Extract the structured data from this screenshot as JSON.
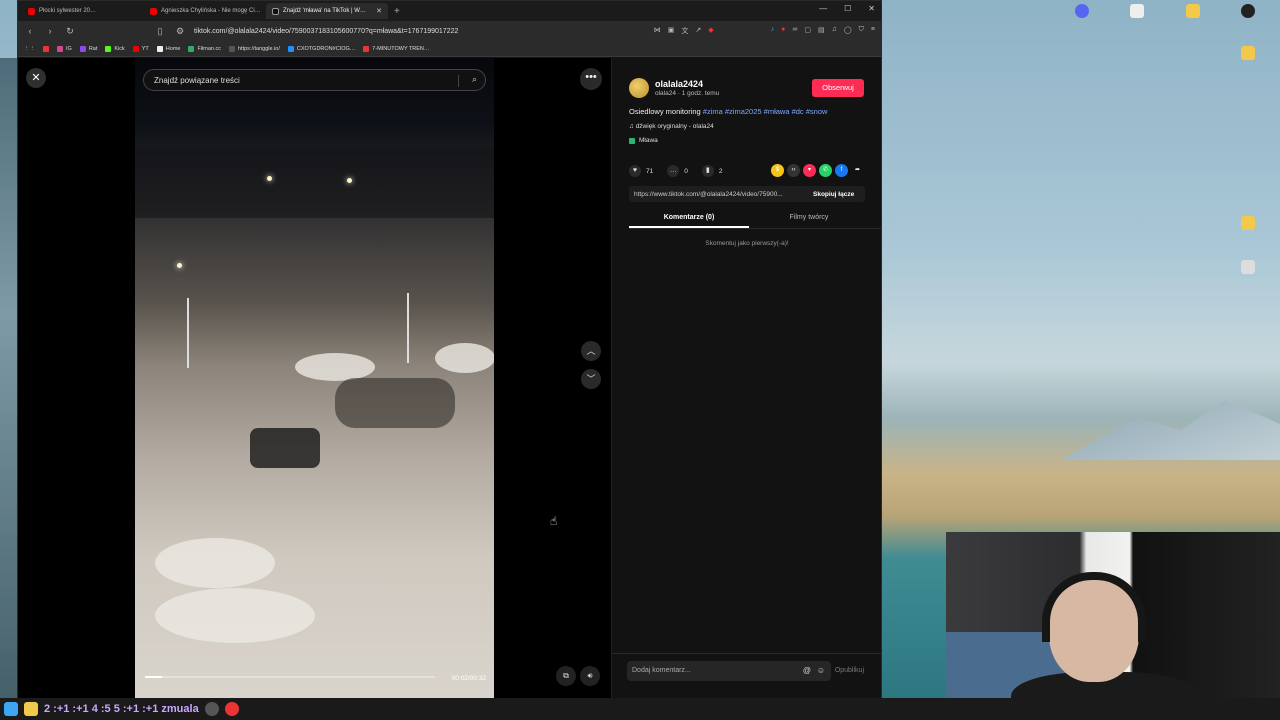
{
  "browser": {
    "tabs": [
      {
        "label": "Płocki sylwester 20…",
        "icon": "youtube-icon"
      },
      {
        "label": "Agnieszka Chylińska - Nie mogę Ci…",
        "icon": "youtube-icon"
      },
      {
        "label": "Znajdź 'mława' na TikTok | W…",
        "icon": "tiktok-icon",
        "active": true
      }
    ],
    "url": "tiktok.com/@olalala2424/video/7590037183105600770?q=mława&t=1767199017222",
    "bookmarks": [
      "IG",
      "Rat",
      "Kick",
      "YT",
      "Home",
      "Filman.cc",
      "https://tanggle.io/",
      "CXOTGDRON#CIOG…",
      "7-MINUTOWY TREN…"
    ]
  },
  "page": {
    "search_placeholder": "Znajdź powiązane treści",
    "video_time": "00:02/00:32",
    "video_progress": 0.06
  },
  "post": {
    "username": "olalala2424",
    "meta": "olala24 · 1 godz. temu",
    "follow_label": "Obserwuj",
    "desc_text": "Osiedlowy monitoring ",
    "hashtags": "#zima #zima2025 #mława #dc #snow",
    "sound": "dźwięk oryginalny - olala24",
    "location": "Mława",
    "likes": "71",
    "comments": "0",
    "saves": "2",
    "link": "https://www.tiktok.com/@olalala2424/video/75900...",
    "copy_label": "Skopiuj łącze",
    "tab_comments": "Komentarze (0)",
    "tab_creator": "Filmy twórcy",
    "empty_text": "Skomentuj jako pierwszy(-a)!",
    "comment_placeholder": "Dodaj komentarz...",
    "publish_label": "Opublikuj"
  },
  "taskbar": {
    "text": "2 :+1 :+1 4 :5 5 :+1 :+1 zmuala"
  },
  "colors": {
    "accent": "#fe2c55",
    "hashtag": "#7fa7ff"
  }
}
